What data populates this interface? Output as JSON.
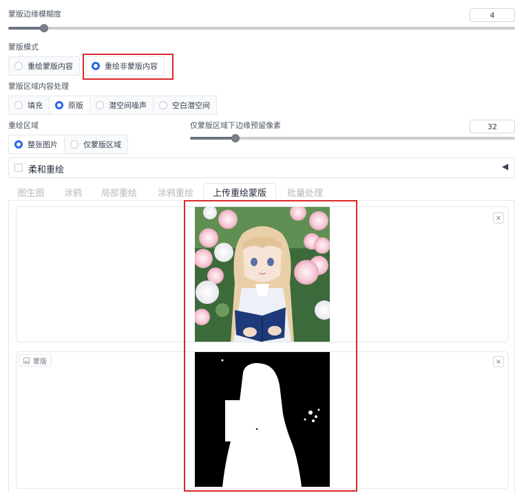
{
  "blur": {
    "label": "蒙版边缘模糊度",
    "value": "4",
    "fraction": 0.07
  },
  "mask_mode": {
    "label": "蒙版模式",
    "options": [
      "重绘蒙版内容",
      "重绘非蒙版内容"
    ],
    "selected": 1
  },
  "fill": {
    "label": "蒙版区域内容处理",
    "options": [
      "填充",
      "原版",
      "潜空间噪声",
      "空白潜空间"
    ],
    "selected": 1
  },
  "area": {
    "label": "重绘区域",
    "options": [
      "整张图片",
      "仅蒙版区域"
    ],
    "selected": 0
  },
  "padding": {
    "label": "仅蒙版区域下边缘预留像素",
    "value": "32",
    "fraction": 0.14
  },
  "soft": {
    "label": "柔和重绘",
    "checked": false,
    "toggle": "◀"
  },
  "tabs": [
    "图生图",
    "涂鸦",
    "局部重绘",
    "涂鸦重绘",
    "上传重绘蒙版",
    "批量处理"
  ],
  "active_tab": 4,
  "mask_panel": {
    "label": "蒙版"
  },
  "icons": {
    "close": "×"
  },
  "colors": {
    "accent": "#2563eb",
    "highlight": "#dc2626"
  }
}
